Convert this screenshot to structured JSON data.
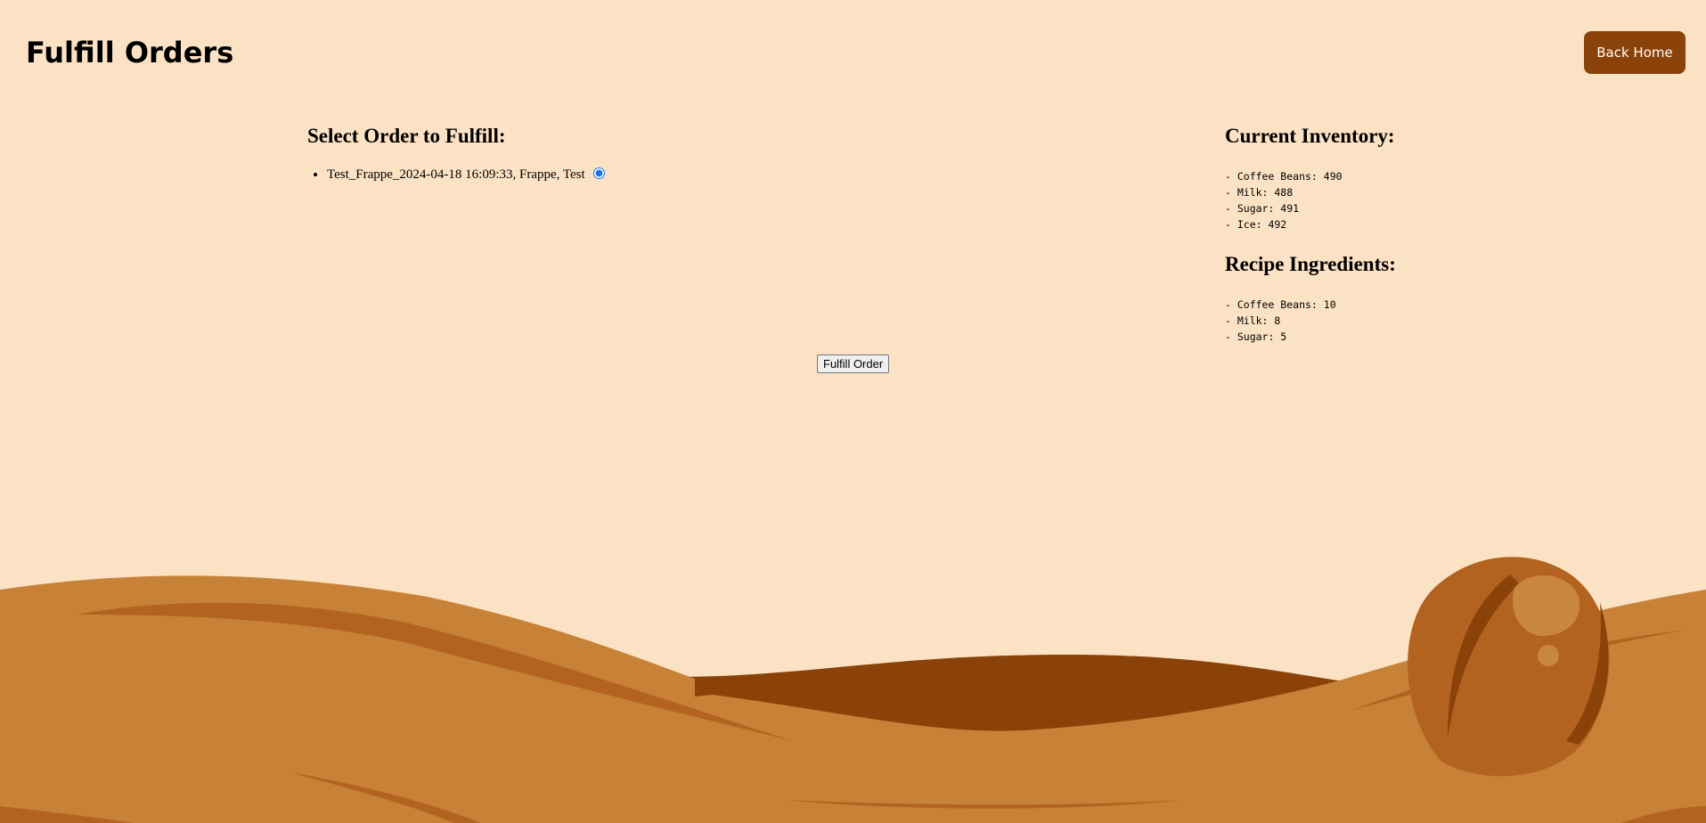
{
  "header": {
    "title": "Fulfill Orders",
    "back_home_label": "Back Home"
  },
  "orders": {
    "heading": "Select Order to Fulfill:",
    "items": [
      {
        "label": "Test_Frappe_2024-04-18 16:09:33, Frappe, Test",
        "selected": true
      }
    ],
    "fulfill_label": "Fulfill Order"
  },
  "inventory": {
    "heading": "Current Inventory:",
    "lines": [
      "- Coffee Beans: 490",
      "- Milk: 488",
      "- Sugar: 491",
      "- Ice: 492"
    ]
  },
  "recipe": {
    "heading": "Recipe Ingredients:",
    "lines": [
      "- Coffee Beans: 10",
      "- Milk: 8",
      "- Sugar: 5"
    ]
  },
  "colors": {
    "background": "#FCE2C4",
    "accent": "#8B4209",
    "sand": "#C88237",
    "sand_dark": "#B2631F",
    "bean_light": "#C8863E"
  },
  "decor": {
    "background_icon": "coffee-bean-icon"
  }
}
